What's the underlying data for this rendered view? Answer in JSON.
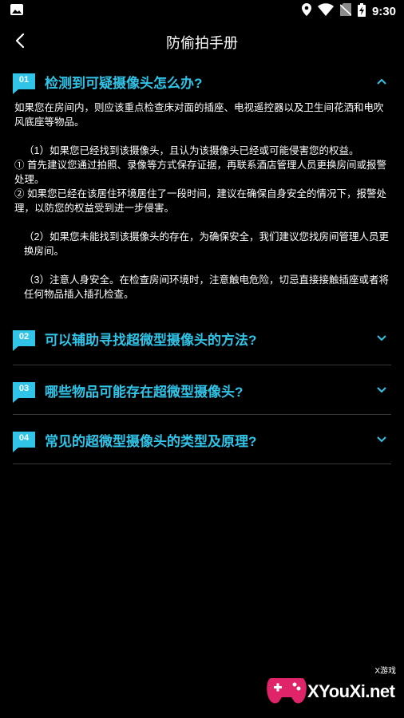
{
  "status_bar": {
    "time": "9:30",
    "icons": [
      "image-icon",
      "location-icon",
      "wifi-icon",
      "no-sim-icon",
      "battery-charging-icon"
    ]
  },
  "header": {
    "title": "防偷拍手册",
    "back_icon": "back-arrow-icon"
  },
  "colors": {
    "accent": "#2fc4e8",
    "background": "#000000",
    "divider": "#3a3a3a"
  },
  "faq": [
    {
      "num": "01",
      "question": "检测到可疑摄像头怎么办?",
      "expanded": true,
      "answer": [
        "如果您在房间内，则应该重点检查床对面的插座、电视遥控器以及卫生间花洒和电吹风底座等物品。",
        "（1）如果您已经找到该摄像头，且认为该摄像头已经或可能侵害您的权益。",
        "① 首先建议您通过拍照、录像等方式保存证据，再联系酒店管理人员更换房间或报警处理。",
        "② 如果您已经在该居住环境居住了一段时间，建议在确保自身安全的情况下，报警处理，以防您的权益受到进一步侵害。",
        "（2）如果您未能找到该摄像头的存在，为确保安全，我们建议您找房间管理人员更换房间。",
        "（3）注意人身安全。在检查房间环境时，注意触电危险，切忌直接接触插座或者将任何物品插入插孔检查。"
      ]
    },
    {
      "num": "02",
      "question": "可以辅助寻找超微型摄像头的方法?",
      "expanded": false
    },
    {
      "num": "03",
      "question": "哪些物品可能存在超微型摄像头?",
      "expanded": false
    },
    {
      "num": "04",
      "question": "常见的超微型摄像头的类型及原理?",
      "expanded": false
    }
  ],
  "watermark": {
    "text": "XYouXi.net",
    "tag": "X游戏"
  }
}
